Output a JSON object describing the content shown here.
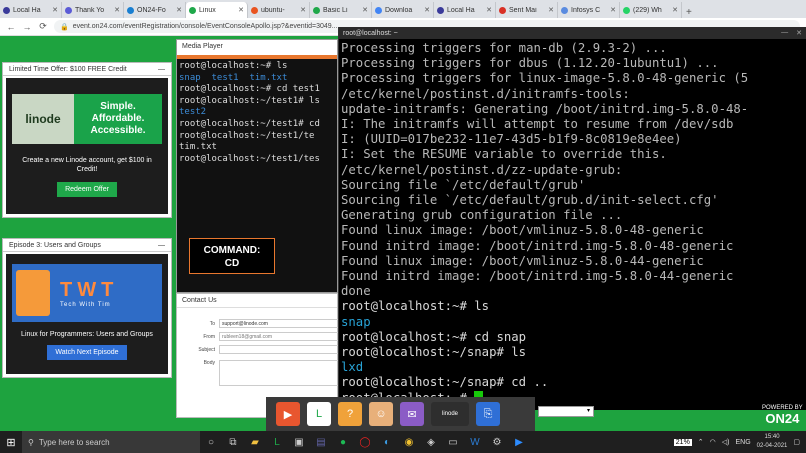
{
  "browser": {
    "tabs": [
      {
        "label": "Local Ha",
        "color": "#3a3a9a"
      },
      {
        "label": "Thank Yo",
        "color": "#5b5bd6"
      },
      {
        "label": "ON24-Fo",
        "color": "#1a7fd1"
      },
      {
        "label": "Linux",
        "color": "#1fa84a",
        "active": true
      },
      {
        "label": "ubuntu-",
        "color": "#e95420"
      },
      {
        "label": "Basic Li",
        "color": "#1fa84a"
      },
      {
        "label": "Downloa",
        "color": "#4285f4"
      },
      {
        "label": "Local Ha",
        "color": "#3a3a9a"
      },
      {
        "label": "Sent Mai",
        "color": "#d93025"
      },
      {
        "label": "Infosys C",
        "color": "#5a8be0"
      },
      {
        "label": "(229) Wh",
        "color": "#25d366"
      }
    ],
    "url": "event.on24.com/eventRegistration/console/EventConsoleApollo.jsp?&eventid=3049..."
  },
  "ad_panel": {
    "title": "Limited Time Offer: $100 FREE Credit",
    "brand": "linode",
    "slogan": [
      "Simple.",
      "Affordable.",
      "Accessible."
    ],
    "text": "Create a new Linode account, get $100 in Credit!",
    "button": "Redeem Offer"
  },
  "episode_panel": {
    "title": "Episode 3: Users and Groups",
    "brand": "TWT",
    "brand_sub": "Tech With Tim",
    "text": "Linux for Programmers: Users and Groups",
    "button": "Watch Next Episode"
  },
  "media_player": {
    "title": "Media Player",
    "lines": [
      {
        "text": "root@localhost:~# ls"
      },
      {
        "text": "snap  test1  tim.txt",
        "blue": true
      },
      {
        "text": "root@localhost:~# cd test1"
      },
      {
        "text": "root@localhost:~/test1# ls"
      },
      {
        "text": "test2",
        "blue": true
      },
      {
        "text": "root@localhost:~/test1# cd"
      },
      {
        "text": "root@localhost:~/test1/te"
      },
      {
        "text": "tim.txt"
      },
      {
        "text": "root@localhost:~/test1/tes"
      }
    ],
    "command_label": "COMMAND:",
    "command_value": "CD"
  },
  "contact": {
    "title": "Contact Us",
    "to_label": "To",
    "to_value": "support@linode.com",
    "from_label": "From",
    "from_value": "rubleen18@gmail.com",
    "subject_label": "Subject",
    "body_label": "Body"
  },
  "terminal": {
    "title": "root@localhost: ~",
    "lines": [
      {
        "text": "Processing triggers for man-db (2.9.3-2) ..."
      },
      {
        "text": "Processing triggers for dbus (1.12.20-1ubuntu1) ..."
      },
      {
        "text": "Processing triggers for linux-image-5.8.0-48-generic (5"
      },
      {
        "text": "/etc/kernel/postinst.d/initramfs-tools:"
      },
      {
        "text": "update-initramfs: Generating /boot/initrd.img-5.8.0-48-"
      },
      {
        "text": "I: The initramfs will attempt to resume from /dev/sdb"
      },
      {
        "text": "I: (UUID=017be232-11e7-43d5-b1f9-8c0819e8e4ee)"
      },
      {
        "text": "I: Set the RESUME variable to override this."
      },
      {
        "text": "/etc/kernel/postinst.d/zz-update-grub:"
      },
      {
        "text": "Sourcing file `/etc/default/grub'"
      },
      {
        "text": "Sourcing file `/etc/default/grub.d/init-select.cfg'"
      },
      {
        "text": "Generating grub configuration file ..."
      },
      {
        "text": "Found linux image: /boot/vmlinuz-5.8.0-48-generic"
      },
      {
        "text": "Found initrd image: /boot/initrd.img-5.8.0-48-generic"
      },
      {
        "text": "Found linux image: /boot/vmlinuz-5.8.0-44-generic"
      },
      {
        "text": "Found initrd image: /boot/initrd.img-5.8.0-44-generic"
      },
      {
        "text": "done"
      },
      {
        "text": "root@localhost:~# ls",
        "prompt": true
      },
      {
        "text": "snap",
        "cyan": true
      },
      {
        "text": "root@localhost:~# cd snap",
        "prompt": true
      },
      {
        "text": "root@localhost:~/snap# ls",
        "prompt": true
      },
      {
        "text": "lxd",
        "cyan": true
      },
      {
        "text": "root@localhost:~/snap# cd ..",
        "prompt": true
      },
      {
        "text": "root@localhost:~# ",
        "prompt": true,
        "cursor": true
      }
    ]
  },
  "dock": {
    "items": [
      {
        "icon": "play-icon",
        "color": "#e8562f",
        "glyph": "▶"
      },
      {
        "icon": "linode-icon",
        "color": "#ffffff",
        "glyph": "L"
      },
      {
        "icon": "question-icon",
        "color": "#f0a23a",
        "glyph": "?"
      },
      {
        "icon": "avatar-icon",
        "color": "#e8b07a",
        "glyph": "☺"
      },
      {
        "icon": "mail-icon",
        "color": "#8b5cc6",
        "glyph": "✉"
      },
      {
        "icon": "linode-banner-icon",
        "color": "#2e2e2e",
        "glyph": "▪"
      },
      {
        "icon": "attachment-icon",
        "color": "#2f6fd6",
        "glyph": "⎘"
      }
    ],
    "banner_label": "linode"
  },
  "overlay": {
    "powered_by": "POWERED BY",
    "on24": "ON24"
  },
  "taskbar": {
    "search_placeholder": "Type here to search",
    "battery": "21%",
    "language": "ENG",
    "time": "15:40",
    "date": "02-04-2021"
  }
}
